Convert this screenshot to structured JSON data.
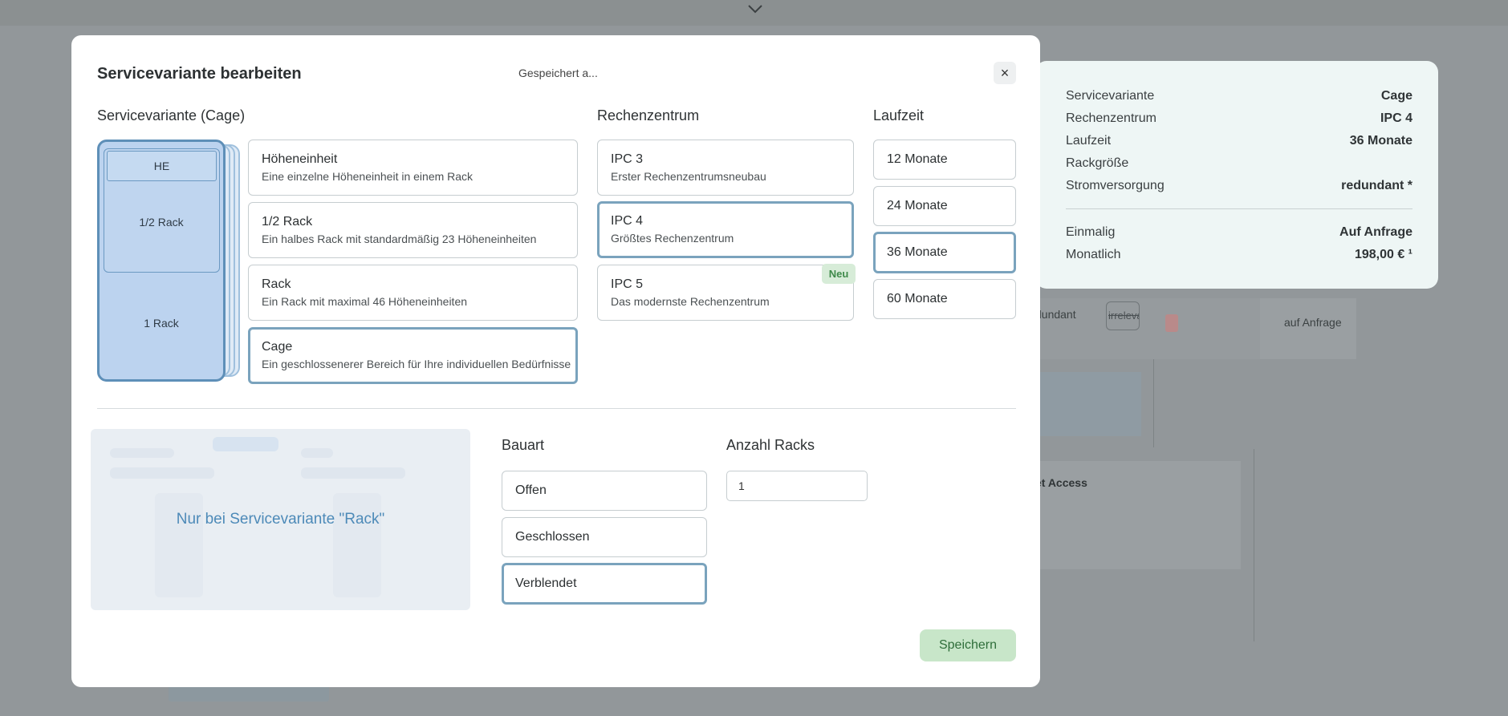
{
  "background": {
    "list_item_1": "dundant",
    "list_item_2": "irrelevа",
    "list_item_3": "auf Anfrage",
    "section_label": "et Access"
  },
  "summary": {
    "rows": [
      {
        "label": "Servicevariante",
        "value": "Cage"
      },
      {
        "label": "Rechenzentrum",
        "value": "IPC 4"
      },
      {
        "label": "Laufzeit",
        "value": "36 Monate"
      },
      {
        "label": "Rackgröße",
        "value": ""
      },
      {
        "label": "Stromversorgung",
        "value": "redundant *"
      }
    ],
    "costs": [
      {
        "label": "Einmalig",
        "value": "Auf Anfrage"
      },
      {
        "label": "Monatlich",
        "value": "198,00 € ¹"
      }
    ]
  },
  "modal": {
    "title": "Servicevariante bearbeiten",
    "saved_hint": "Gespeichert a...",
    "close_label": "×",
    "save_label": "Speichern",
    "service": {
      "title": "Servicevariante (Cage)",
      "visual": {
        "he": "HE",
        "half": "1/2 Rack",
        "full": "1 Rack"
      },
      "options": [
        {
          "title": "Höheneinheit",
          "desc": "Eine einzelne Höheneinheit in einem Rack",
          "selected": false
        },
        {
          "title": "1/2 Rack",
          "desc": "Ein halbes Rack mit standardmäßig 23 Höheneinheiten",
          "selected": false
        },
        {
          "title": "Rack",
          "desc": "Ein Rack mit maximal 46 Höheneinheiten",
          "selected": false
        },
        {
          "title": "Cage",
          "desc": "Ein geschlossenerer Bereich für Ihre individuellen Bedürfnisse",
          "selected": true
        }
      ]
    },
    "datacenter": {
      "title": "Rechenzentrum",
      "badge": "Neu",
      "options": [
        {
          "title": "IPC 3",
          "desc": "Erster Rechenzentrumsneubau",
          "selected": false
        },
        {
          "title": "IPC 4",
          "desc": "Größtes Rechenzentrum",
          "selected": true
        },
        {
          "title": "IPC 5",
          "desc": "Das modernste Rechenzentrum",
          "selected": false
        }
      ]
    },
    "term": {
      "title": "Laufzeit",
      "options": [
        {
          "label": "12 Monate",
          "selected": false
        },
        {
          "label": "24 Monate",
          "selected": false
        },
        {
          "label": "36 Monate",
          "selected": true
        },
        {
          "label": "60 Monate",
          "selected": false
        }
      ]
    },
    "rack_hint": "Nur bei Servicevariante \"Rack\"",
    "construction": {
      "title": "Bauart",
      "options": [
        {
          "label": "Offen",
          "selected": false
        },
        {
          "label": "Geschlossen",
          "selected": false
        },
        {
          "label": "Verblendet",
          "selected": true
        }
      ]
    },
    "rack_count": {
      "title": "Anzahl Racks",
      "value": "1"
    }
  }
}
